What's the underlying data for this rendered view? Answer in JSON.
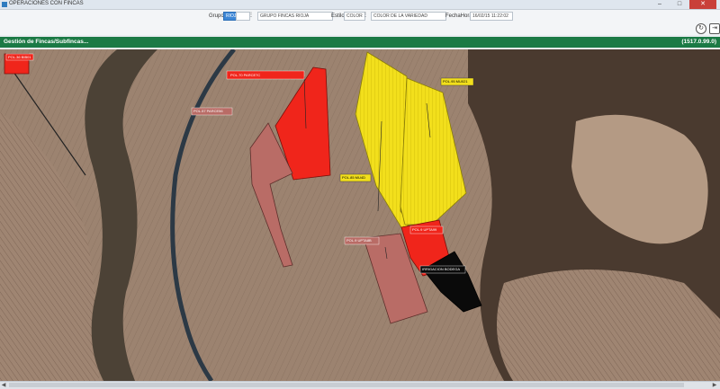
{
  "window": {
    "title": "OPERACIONES CON FINCAS"
  },
  "toolbar": {
    "grupo_label": "Grupo",
    "grupo_value": "RIOJA",
    "grupo_name": "GRUPO FINCAS RIOJA",
    "estilo_label": "Estilo",
    "estilo_value": "COLOR",
    "estilo_name": "COLOR DE LA VARIEDAD",
    "fecha_label": "FechaHora",
    "fecha_value": "16/02/15 11:22:02"
  },
  "header": {
    "title": "Gestión de Fincas/Subfincas...",
    "code": "(1517.0.99.0)"
  },
  "map": {
    "labels": {
      "top_left": "POL.36 BIB01",
      "top_red": "POL.70 PARCE7C",
      "pink_left": "POL.57 PARCE56",
      "center": "POL.85 MU4D",
      "yellow_right": "POL.95 MU021",
      "bottom_red": "POL.9 UPTA99",
      "bottom_pink": "POL.9 UPTA8B",
      "black": "IRRIGACION BODEGA"
    },
    "colors": {
      "red": "#f0251b",
      "pink": "#b96c66",
      "yellow": "#f2df1c",
      "black": "#0a0a0a"
    }
  }
}
